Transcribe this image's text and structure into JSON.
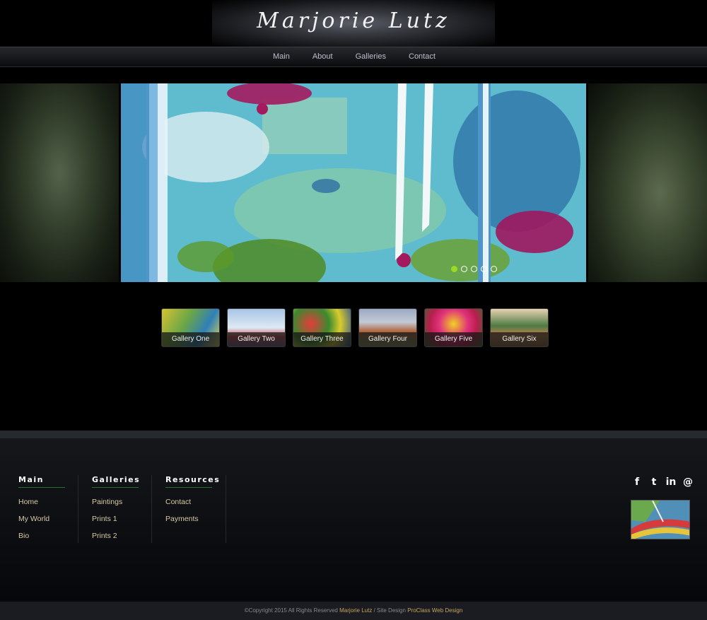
{
  "header": {
    "title": "Marjorie Lutz"
  },
  "nav": {
    "items": [
      {
        "label": "Main"
      },
      {
        "label": "About"
      },
      {
        "label": "Galleries"
      },
      {
        "label": "Contact"
      }
    ]
  },
  "slider": {
    "slide_count": 5,
    "active_index": 0
  },
  "galleries": [
    {
      "label": "Gallery One"
    },
    {
      "label": "Gallery Two"
    },
    {
      "label": "Gallery Three"
    },
    {
      "label": "Gallery Four"
    },
    {
      "label": "Gallery Five"
    },
    {
      "label": "Gallery Six"
    }
  ],
  "footer": {
    "columns": [
      {
        "heading": "Main",
        "links": [
          "Home",
          "My World",
          "Bio"
        ]
      },
      {
        "heading": "Galleries",
        "links": [
          "Paintings",
          "Prints 1",
          "Prints 2"
        ]
      },
      {
        "heading": "Resources",
        "links": [
          "Contact",
          "Payments"
        ]
      }
    ],
    "socials": [
      {
        "icon": "facebook-icon",
        "glyph": "f"
      },
      {
        "icon": "twitter-icon",
        "glyph": "t"
      },
      {
        "icon": "linkedin-icon",
        "glyph": "in"
      },
      {
        "icon": "email-icon",
        "glyph": "@"
      }
    ],
    "copyright": {
      "prefix": "©Copyright 2015 All Rights Reserved",
      "owner": "Marjorie Lutz",
      "middle": "/ Site Design",
      "designer": "ProClass Web Design"
    }
  },
  "colors": {
    "accent_dot": "#9cd824",
    "link_gold": "#c9a55a",
    "footer_link": "#d8c9a5"
  }
}
